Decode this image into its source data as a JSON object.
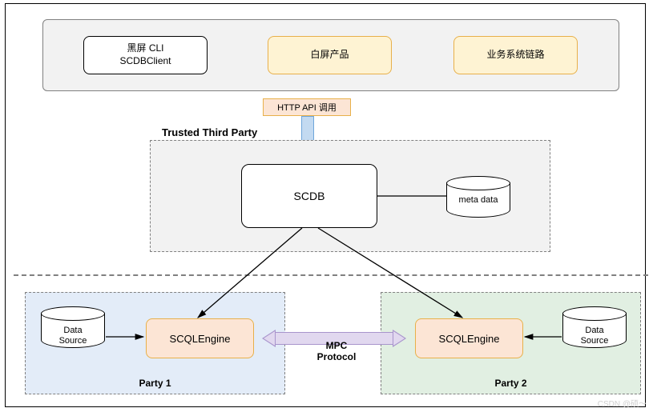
{
  "clients": {
    "cli": {
      "line1": "黑屏 CLI",
      "line2": "SCDBClient"
    },
    "white_product": "白屏产品",
    "biz_link": "业务系统链路"
  },
  "api_call_label": "HTTP API 调用",
  "ttp": {
    "title": "Trusted Third Party",
    "scdb": "SCDB",
    "meta_data": "meta data"
  },
  "party1": {
    "label": "Party 1",
    "engine": "SCQLEngine",
    "data_source_line1": "Data",
    "data_source_line2": "Source"
  },
  "party2": {
    "label": "Party 2",
    "engine": "SCQLEngine",
    "data_source_line1": "Data",
    "data_source_line2": "Source"
  },
  "mpc_line1": "MPC",
  "mpc_line2": "Protocol",
  "watermark": "CSDN @硕～",
  "connections": [
    {
      "from": "clients-box",
      "to": "scdb",
      "via": "http-api-arrow",
      "kind": "thick-arrow-down"
    },
    {
      "from": "scdb",
      "to": "meta-data-db",
      "kind": "line"
    },
    {
      "from": "scdb",
      "to": "scql-engine-1",
      "kind": "arrow"
    },
    {
      "from": "scdb",
      "to": "scql-engine-2",
      "kind": "arrow"
    },
    {
      "from": "data-source-1",
      "to": "scql-engine-1",
      "kind": "arrow"
    },
    {
      "from": "data-source-2",
      "to": "scql-engine-2",
      "kind": "arrow"
    },
    {
      "from": "scql-engine-1",
      "to": "scql-engine-2",
      "kind": "double-arrow",
      "label": "MPC Protocol"
    }
  ]
}
